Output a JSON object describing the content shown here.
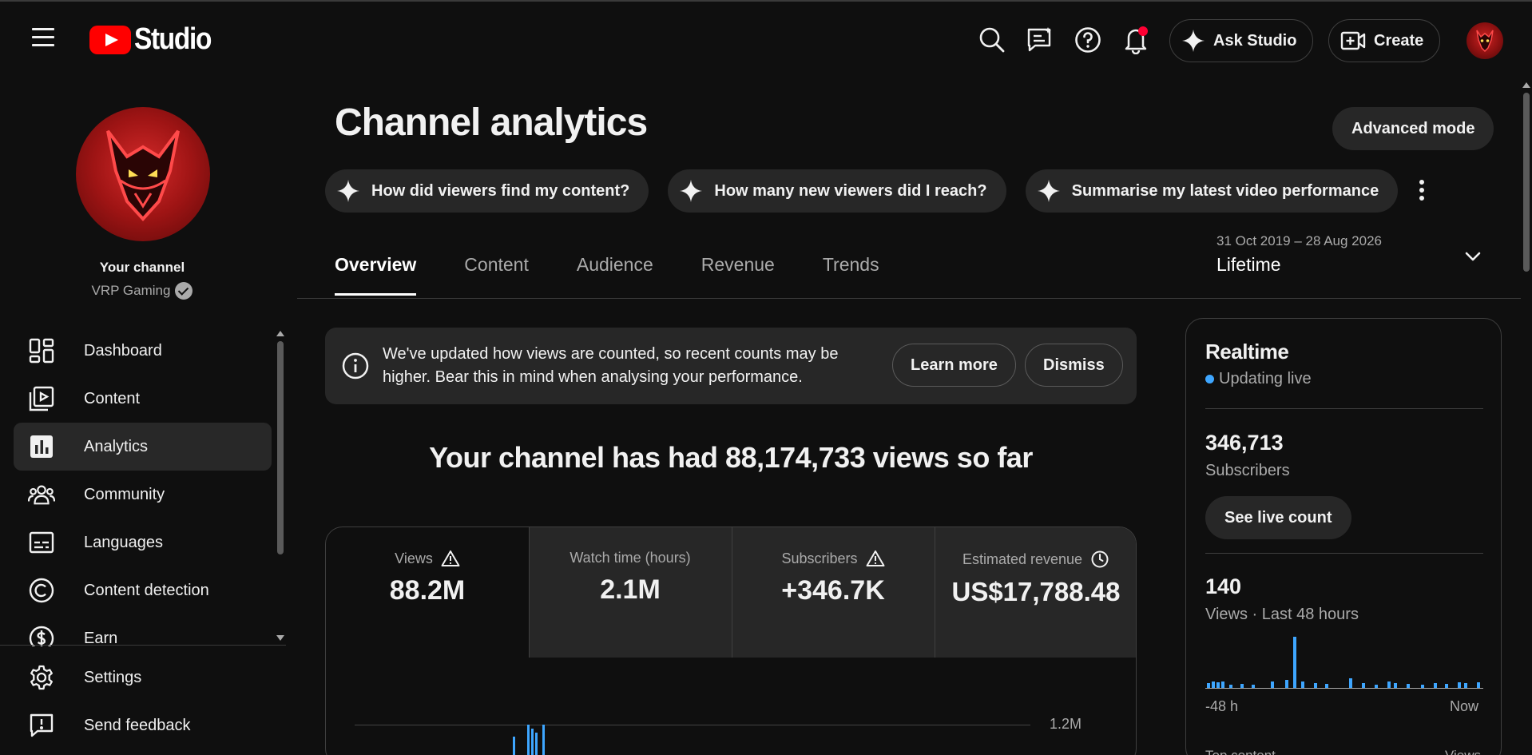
{
  "app": {
    "logo_text": "Studio",
    "brand_color": "#ff0000",
    "accent_color": "#3ea6ff"
  },
  "header": {
    "ask_studio": "Ask Studio",
    "create": "Create",
    "icons": [
      "menu-icon",
      "search-icon",
      "feedback-chat-icon",
      "help-icon",
      "notifications-icon"
    ]
  },
  "sidebar": {
    "your_channel": "Your channel",
    "channel_name": "VRP Gaming",
    "items": [
      {
        "label": "Dashboard",
        "icon": "dashboard-icon"
      },
      {
        "label": "Content",
        "icon": "content-icon"
      },
      {
        "label": "Analytics",
        "icon": "analytics-icon",
        "active": true
      },
      {
        "label": "Community",
        "icon": "community-icon"
      },
      {
        "label": "Languages",
        "icon": "languages-icon"
      },
      {
        "label": "Content detection",
        "icon": "copyright-icon"
      },
      {
        "label": "Earn",
        "icon": "earn-icon"
      }
    ],
    "bottom": [
      {
        "label": "Settings",
        "icon": "settings-icon"
      },
      {
        "label": "Send feedback",
        "icon": "send-feedback-icon"
      }
    ]
  },
  "main": {
    "title": "Channel analytics",
    "advanced_mode": "Advanced mode",
    "chips": [
      "How did viewers find my content?",
      "How many new viewers did I reach?",
      "Summarise my latest video performance"
    ],
    "tabs": [
      "Overview",
      "Content",
      "Audience",
      "Revenue",
      "Trends"
    ],
    "active_tab": "Overview",
    "date_range": {
      "range": "31 Oct 2019 – 28 Aug 2026",
      "label": "Lifetime"
    },
    "notice": {
      "text": "We've updated how views are counted, so recent counts may be higher. Bear this in mind when analysing your performance.",
      "learn_more": "Learn more",
      "dismiss": "Dismiss"
    },
    "headline": "Your channel has had 88,174,733 views so far",
    "metrics": [
      {
        "label": "Views",
        "value": "88.2M",
        "icon": "warning-icon"
      },
      {
        "label": "Watch time (hours)",
        "value": "2.1M"
      },
      {
        "label": "Subscribers",
        "value": "+346.7K",
        "icon": "warning-icon"
      },
      {
        "label": "Estimated revenue",
        "value": "US$17,788.48",
        "icon": "clock-icon"
      }
    ],
    "chart_gridline_label": "1.2M"
  },
  "realtime": {
    "title": "Realtime",
    "status": "Updating live",
    "subscribers_value": "346,713",
    "subscribers_label": "Subscribers",
    "see_live_count": "See live count",
    "views_value": "140",
    "views_label": "Views · Last 48 hours",
    "x_start": "-48 h",
    "x_end": "Now",
    "top_content": "Top content",
    "views_col": "Views"
  }
}
